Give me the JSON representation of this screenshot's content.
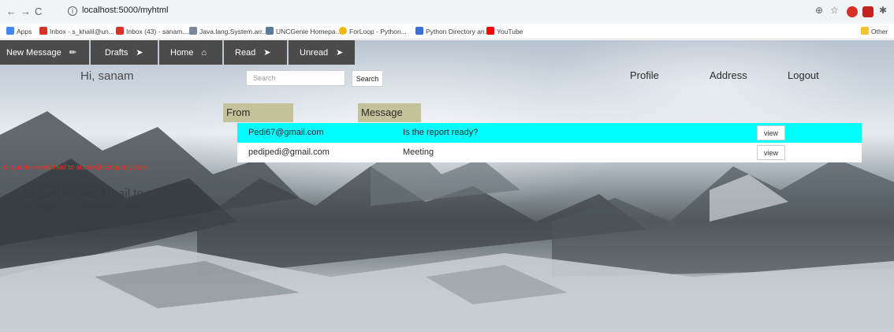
{
  "browser": {
    "url": "localhost:5000/myhtml",
    "bookmarks": [
      {
        "label": "Apps",
        "color": "#4285f4"
      },
      {
        "label": "Inbox - s_khalil@un...",
        "color": "#d93025"
      },
      {
        "label": "Inbox (43) - sanam....",
        "color": "#d93025"
      },
      {
        "label": "Java.lang.System.arr...",
        "color": "#7a8a9a"
      },
      {
        "label": "UNCGenie Homepa...",
        "color": "#5a7a9a"
      },
      {
        "label": "ForLoop - Python...",
        "color": "#f2b705"
      },
      {
        "label": "Python Directory an...",
        "color": "#3b6fd8"
      },
      {
        "label": "YouTube",
        "color": "#ff0000"
      }
    ],
    "other_bookmarks": "Other"
  },
  "nav": {
    "items": [
      {
        "label": "New Message",
        "icon": "pencil-icon",
        "glyph": "✏"
      },
      {
        "label": "Drafts",
        "icon": "paper-plane-icon",
        "glyph": "➤"
      },
      {
        "label": "Home",
        "icon": "home-icon",
        "glyph": "⌂"
      },
      {
        "label": "Read",
        "icon": "paper-plane-icon",
        "glyph": "➤"
      },
      {
        "label": "Unread",
        "icon": "paper-plane-icon",
        "glyph": "➤"
      }
    ]
  },
  "greeting": "Hi, sanam",
  "search": {
    "placeholder": "Search",
    "button_label": "Search"
  },
  "links": {
    "profile": "Profile",
    "address": "Address",
    "logout": "Logout"
  },
  "table": {
    "headers": {
      "from": "From",
      "message": "Message"
    },
    "rows": [
      {
        "from": "Pedi67@gmail.com",
        "message": "Is the report ready?",
        "action": "view",
        "bg": "#00ffff"
      },
      {
        "from": "pedipedi@gmail.com",
        "message": "Meeting",
        "action": "view",
        "bg": "#ffffff"
      }
    ]
  },
  "query_notice": {
    "red": "or queries send mail to admin@company.com",
    "large": "or queries send mail to admin@company.com"
  }
}
